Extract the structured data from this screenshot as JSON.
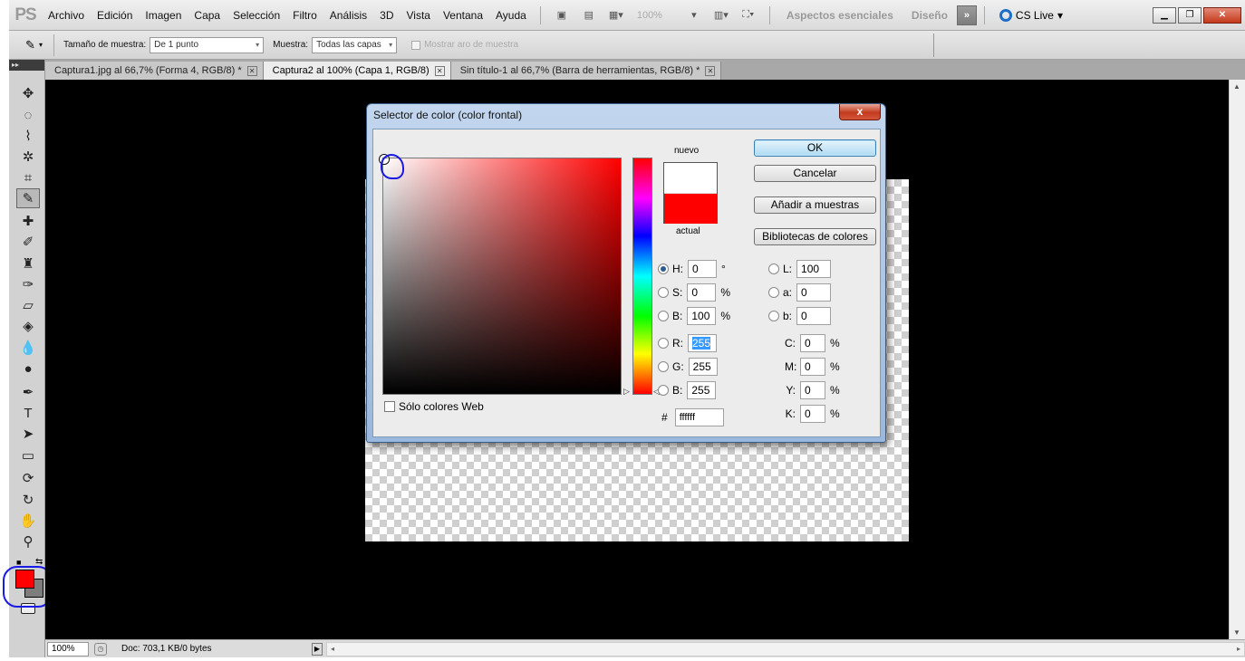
{
  "app": {
    "logo": "PS",
    "menu": [
      "Archivo",
      "Edición",
      "Imagen",
      "Capa",
      "Selección",
      "Filtro",
      "Análisis",
      "3D",
      "Vista",
      "Ventana",
      "Ayuda"
    ],
    "zoom": "100%",
    "workspaces": [
      "Aspectos esenciales",
      "Diseño"
    ],
    "more_label": "»",
    "cslive": "CS Live"
  },
  "options_bar": {
    "sample_size_label": "Tamaño de muestra:",
    "sample_size_value": "De 1 punto",
    "sample_label": "Muestra:",
    "sample_value": "Todas las capas",
    "ring_label": "Mostrar aro de muestra"
  },
  "tabs": [
    {
      "label": "Captura1.jpg al 66,7% (Forma 4, RGB/8) *",
      "active": false
    },
    {
      "label": "Captura2 al 100% (Capa 1, RGB/8)",
      "active": true
    },
    {
      "label": "Sin título-1 al 66,7% (Barra de  herramientas, RGB/8) *",
      "active": false
    }
  ],
  "status": {
    "zoom": "100%",
    "doc": "Doc: 703,1 KB/0 bytes"
  },
  "tools": {
    "foreground": "#ff0000",
    "background": "#7d7d7d"
  },
  "dialog": {
    "title": "Selector de color (color frontal)",
    "close": "x",
    "new_label": "nuevo",
    "current_label": "actual",
    "new_color": "#ffffff",
    "current_color": "#ff0000",
    "buttons": {
      "ok": "OK",
      "cancel": "Cancelar",
      "add_swatches": "Añadir a muestras",
      "libraries": "Bibliotecas de colores"
    },
    "web_only_label": "Sólo colores Web",
    "hsb": [
      {
        "label": "H:",
        "value": "0",
        "unit": "°",
        "selected": true
      },
      {
        "label": "S:",
        "value": "0",
        "unit": "%",
        "selected": false
      },
      {
        "label": "B:",
        "value": "100",
        "unit": "%",
        "selected": false
      }
    ],
    "rgb": [
      {
        "label": "R:",
        "value": "255"
      },
      {
        "label": "G:",
        "value": "255"
      },
      {
        "label": "B:",
        "value": "255"
      }
    ],
    "lab": [
      {
        "label": "L:",
        "value": "100"
      },
      {
        "label": "a:",
        "value": "0"
      },
      {
        "label": "b:",
        "value": "0"
      }
    ],
    "cmyk": [
      {
        "label": "C:",
        "value": "0",
        "unit": "%"
      },
      {
        "label": "M:",
        "value": "0",
        "unit": "%"
      },
      {
        "label": "Y:",
        "value": "0",
        "unit": "%"
      },
      {
        "label": "K:",
        "value": "0",
        "unit": "%"
      }
    ],
    "hex_label": "#",
    "hex_value": "ffffff"
  }
}
